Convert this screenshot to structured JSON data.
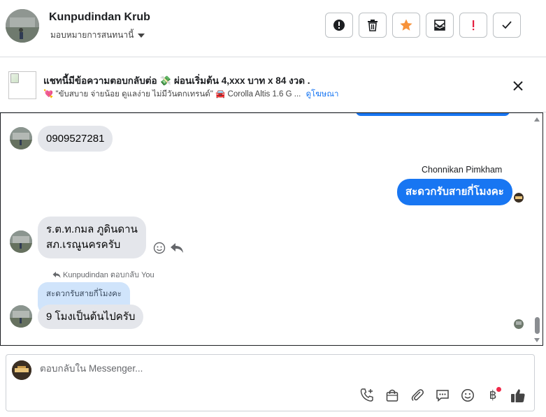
{
  "header": {
    "contact_name": "Kunpudindan Krub",
    "assign_label": "มอบหมายการสนทนานี้",
    "actions": [
      {
        "name": "alert-button",
        "icon": "info-circle-icon"
      },
      {
        "name": "delete-button",
        "icon": "trash-icon"
      },
      {
        "name": "star-button",
        "icon": "star-icon",
        "color": "#f7923a"
      },
      {
        "name": "mark-unread-button",
        "icon": "envelope-icon"
      },
      {
        "name": "spam-button",
        "icon": "exclamation-icon",
        "color": "#e41e3f"
      },
      {
        "name": "done-button",
        "icon": "checkmark-icon"
      }
    ]
  },
  "ad": {
    "title": "แชทนี้มีข้อความตอบกลับต่อ 💸 ผ่อนเริ่มต้น 4,xxx บาท x 84 งวด .",
    "subtitle": "💘 \"ขับสบาย จ่ายน้อย ดูแลง่าย ไม่มีวันตกเทรนด์\" 🚘 Corolla Altis 1.6 G ...",
    "link": "ดูโฆษณา",
    "close_icon": "close-icon"
  },
  "messages": {
    "m1": {
      "text": "0909527281",
      "direction": "incoming"
    },
    "m2": {
      "sender": "Chonnikan Pimkham",
      "text": "สะดวกรับสายกี่โมงคะ",
      "direction": "outgoing"
    },
    "m3": {
      "line1": "ร.ต.ท.กมล ภูดินดาน",
      "line2": "สภ.เรณูนครครับ",
      "direction": "incoming"
    },
    "m4": {
      "reply_meta": "Kunpudindan ตอบกลับ You",
      "quoted": "สะดวกรับสายกี่โมงคะ",
      "text": "9 โมงเป็นต้นไปครับ",
      "direction": "incoming"
    }
  },
  "composer": {
    "placeholder": "ตอบกลับใน Messenger...",
    "tools": [
      "phone-plus-icon",
      "shopping-bag-icon",
      "paperclip-icon",
      "saved-reply-icon",
      "emoji-icon",
      "baht-payment-icon",
      "thumbs-up-icon"
    ],
    "baht_symbol": "฿",
    "accent": "#1876f2"
  }
}
